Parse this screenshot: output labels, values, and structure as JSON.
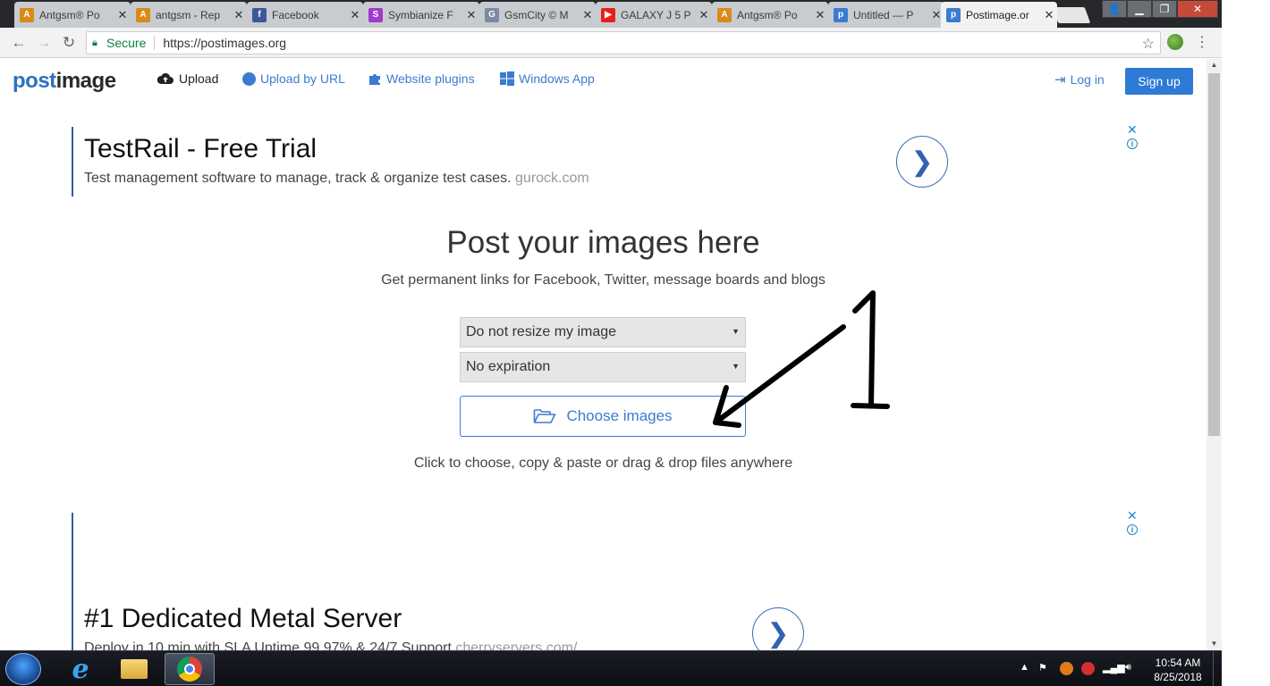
{
  "browser": {
    "tabs": [
      {
        "title": "Antgsm® Po",
        "favicon": "antgsm-icon",
        "color": "#d98a1a"
      },
      {
        "title": "antgsm - Rep",
        "favicon": "antgsm-icon",
        "color": "#d98a1a"
      },
      {
        "title": "Facebook",
        "favicon": "facebook-icon",
        "color": "#3b5998"
      },
      {
        "title": "Symbianize F",
        "favicon": "symbianize-icon",
        "color": "#a03acc"
      },
      {
        "title": "GsmCity © M",
        "favicon": "gsmcity-icon",
        "color": "#7a8aa0"
      },
      {
        "title": "GALAXY J 5 P",
        "favicon": "youtube-icon",
        "color": "#e62117"
      },
      {
        "title": "Antgsm® Po",
        "favicon": "antgsm-icon",
        "color": "#d98a1a"
      },
      {
        "title": "Untitled — P",
        "favicon": "postimage-icon",
        "color": "#3b7bd1"
      },
      {
        "title": "Postimage.or",
        "favicon": "postimage-icon",
        "color": "#3b7bd1"
      }
    ],
    "active_tab": 8,
    "secure_label": "Secure",
    "url": "https://postimages.org"
  },
  "site": {
    "logo_part1": "post",
    "logo_part2": "image",
    "nav": {
      "upload": "Upload",
      "upload_by_url": "Upload by URL",
      "website_plugins": "Website plugins",
      "windows_app": "Windows App",
      "login": "Log in",
      "signup": "Sign up"
    }
  },
  "ads": [
    {
      "title": "TestRail - Free Trial",
      "desc": "Test management software to manage, track & organize test cases.",
      "domain": "gurock.com"
    },
    {
      "title": "#1 Dedicated Metal Server",
      "desc": "Deploy in 10 min with SLA Uptime 99.97% & 24/7 Support",
      "domain": "cherryservers.com/"
    }
  ],
  "upload": {
    "headline": "Post your images here",
    "subline": "Get permanent links for Facebook, Twitter, message boards and blogs",
    "resize_selected": "Do not resize my image",
    "expiration_selected": "No expiration",
    "choose_button": "Choose images",
    "hint": "Click to choose, copy & paste or drag & drop files anywhere"
  },
  "annotation": {
    "number": "1"
  },
  "taskbar": {
    "time": "10:54 AM",
    "date": "8/25/2018"
  }
}
